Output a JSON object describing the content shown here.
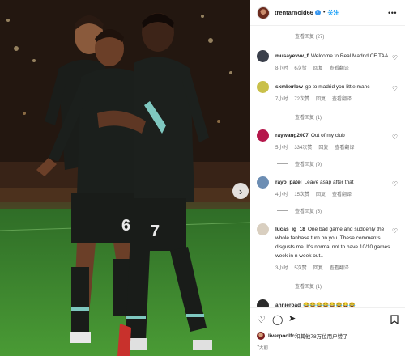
{
  "header": {
    "username": "trentarnold66",
    "verified_icon": "verified-badge-icon",
    "separator": "•",
    "follow_label": "关注",
    "more_icon": "more-horizontal-icon"
  },
  "comments": [
    {
      "type": "replies",
      "label": "查看回复 (27)"
    },
    {
      "type": "comment",
      "user": "musayevvv_f",
      "text": "Welcome to Real Madrid CF TAA",
      "time": "8小时",
      "likes": "6次赞",
      "reply": "回复",
      "translate": "查看翻译",
      "avatar_color": "#3a3f4b"
    },
    {
      "type": "comment",
      "user": "sxmbxrlow",
      "text": "go to madrid you little manc",
      "time": "7小时",
      "likes": "72次赞",
      "reply": "回复",
      "translate": "查看翻译",
      "avatar_color": "#c9c04a"
    },
    {
      "type": "replies",
      "label": "查看回复 (1)"
    },
    {
      "type": "comment",
      "user": "raywang2007",
      "text": "Out of my club",
      "time": "5小时",
      "likes": "334次赞",
      "reply": "回复",
      "translate": "查看翻译",
      "avatar_color": "#b5174b"
    },
    {
      "type": "replies",
      "label": "查看回复 (9)"
    },
    {
      "type": "comment",
      "user": "rayo_patel",
      "text": "Leave asap after that",
      "time": "4小时",
      "likes": "15次赞",
      "reply": "回复",
      "translate": "查看翻译",
      "avatar_color": "#6c8db3"
    },
    {
      "type": "replies",
      "label": "查看回复 (5)"
    },
    {
      "type": "comment",
      "user": "lucas_ig_18",
      "text": "One bad game and suddenly the whole fanbase turn on you. These comments disgusts me. It's normal not to have 10/10 games week in n week out..",
      "time": "3小时",
      "likes": "5次赞",
      "reply": "回复",
      "translate": "查看翻译",
      "avatar_color": "#d9cfc0"
    },
    {
      "type": "replies",
      "label": "查看回复 (1)"
    },
    {
      "type": "comment",
      "user": "annieroad",
      "text": "😂😂😂😂😂😂😂😂",
      "avatar_color": "#2a2a2a"
    }
  ],
  "actions": {
    "like_icon": "heart-icon",
    "comment_icon": "comment-icon",
    "share_icon": "share-icon",
    "save_icon": "bookmark-icon"
  },
  "likes": {
    "user": "liverpoolfc",
    "suffix": "和其他78万位用户赞了"
  },
  "date": "7天前",
  "photo": {
    "jersey_numbers": [
      "6",
      "7"
    ],
    "next_icon": "chevron-right-icon"
  }
}
